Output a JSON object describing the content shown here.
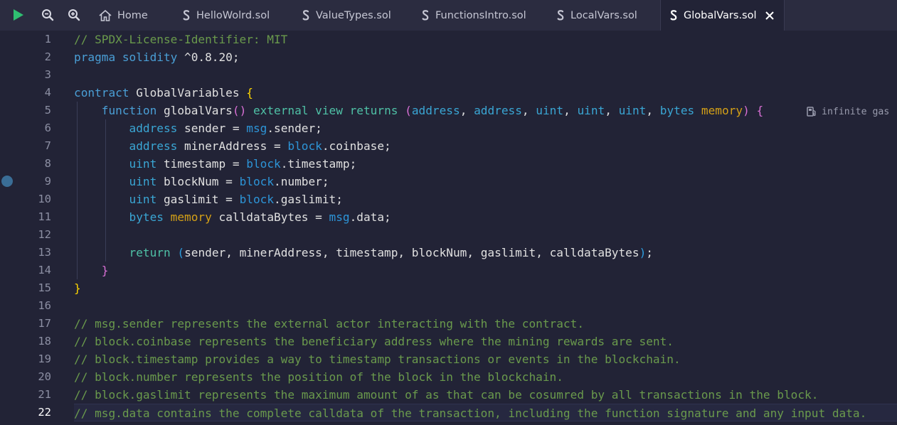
{
  "toolbar": {
    "run_icon": "play-icon",
    "zoom_out_icon": "zoom-out-icon",
    "zoom_in_icon": "zoom-in-icon"
  },
  "tabs": [
    {
      "label": "Home",
      "icon": "home-icon",
      "active": false
    },
    {
      "label": "HelloWolrd.sol",
      "icon": "solidity-icon",
      "active": false
    },
    {
      "label": "ValueTypes.sol",
      "icon": "solidity-icon",
      "active": false
    },
    {
      "label": "FunctionsIntro.sol",
      "icon": "solidity-icon",
      "active": false
    },
    {
      "label": "LocalVars.sol",
      "icon": "solidity-icon",
      "active": false
    },
    {
      "label": "GlobalVars.sol",
      "icon": "solidity-icon",
      "active": true
    }
  ],
  "editor": {
    "current_line": 22,
    "breakpoint_line": 9,
    "gas_hint": "infinite gas",
    "lines": [
      [
        {
          "t": "// SPDX-License-Identifier: MIT",
          "k": "c"
        }
      ],
      [
        {
          "t": "pragma solidity",
          "k": "kw"
        },
        {
          "t": " ^0.8.20;",
          "k": "pl"
        }
      ],
      [],
      [
        {
          "t": "contract",
          "k": "kw"
        },
        {
          "t": " GlobalVariables ",
          "k": "pl"
        },
        {
          "t": "{",
          "k": "br1"
        }
      ],
      [
        {
          "t": "    ",
          "k": "pl"
        },
        {
          "t": "function",
          "k": "kw"
        },
        {
          "t": " globalVars",
          "k": "pl"
        },
        {
          "t": "()",
          "k": "br2"
        },
        {
          "t": " ",
          "k": "pl"
        },
        {
          "t": "external view returns",
          "k": "fn"
        },
        {
          "t": " ",
          "k": "pl"
        },
        {
          "t": "(",
          "k": "br2"
        },
        {
          "t": "address",
          "k": "ty"
        },
        {
          "t": ", ",
          "k": "pl"
        },
        {
          "t": "address",
          "k": "ty"
        },
        {
          "t": ", ",
          "k": "pl"
        },
        {
          "t": "uint",
          "k": "ty"
        },
        {
          "t": ", ",
          "k": "pl"
        },
        {
          "t": "uint",
          "k": "ty"
        },
        {
          "t": ", ",
          "k": "pl"
        },
        {
          "t": "uint",
          "k": "ty"
        },
        {
          "t": ", ",
          "k": "pl"
        },
        {
          "t": "bytes",
          "k": "ty"
        },
        {
          "t": " ",
          "k": "pl"
        },
        {
          "t": "memory",
          "k": "mem"
        },
        {
          "t": ") ",
          "k": "br2"
        },
        {
          "t": "{",
          "k": "br2"
        }
      ],
      [
        {
          "t": "        ",
          "k": "pl"
        },
        {
          "t": "address",
          "k": "ty"
        },
        {
          "t": " sender = ",
          "k": "pl"
        },
        {
          "t": "msg",
          "k": "glb"
        },
        {
          "t": ".sender;",
          "k": "pl"
        }
      ],
      [
        {
          "t": "        ",
          "k": "pl"
        },
        {
          "t": "address",
          "k": "ty"
        },
        {
          "t": " minerAddress = ",
          "k": "pl"
        },
        {
          "t": "block",
          "k": "glb"
        },
        {
          "t": ".coinbase;",
          "k": "pl"
        }
      ],
      [
        {
          "t": "        ",
          "k": "pl"
        },
        {
          "t": "uint",
          "k": "ty"
        },
        {
          "t": " timestamp = ",
          "k": "pl"
        },
        {
          "t": "block",
          "k": "glb"
        },
        {
          "t": ".timestamp;",
          "k": "pl"
        }
      ],
      [
        {
          "t": "        ",
          "k": "pl"
        },
        {
          "t": "uint",
          "k": "ty"
        },
        {
          "t": " blockNum = ",
          "k": "pl"
        },
        {
          "t": "block",
          "k": "glb"
        },
        {
          "t": ".number;",
          "k": "pl"
        }
      ],
      [
        {
          "t": "        ",
          "k": "pl"
        },
        {
          "t": "uint",
          "k": "ty"
        },
        {
          "t": " gaslimit = ",
          "k": "pl"
        },
        {
          "t": "block",
          "k": "glb"
        },
        {
          "t": ".gaslimit;",
          "k": "pl"
        }
      ],
      [
        {
          "t": "        ",
          "k": "pl"
        },
        {
          "t": "bytes",
          "k": "ty"
        },
        {
          "t": " ",
          "k": "pl"
        },
        {
          "t": "memory",
          "k": "mem"
        },
        {
          "t": " calldataBytes = ",
          "k": "pl"
        },
        {
          "t": "msg",
          "k": "glb"
        },
        {
          "t": ".data;",
          "k": "pl"
        }
      ],
      [],
      [
        {
          "t": "        ",
          "k": "pl"
        },
        {
          "t": "return",
          "k": "fn"
        },
        {
          "t": " ",
          "k": "pl"
        },
        {
          "t": "(",
          "k": "br3"
        },
        {
          "t": "sender, minerAddress, timestamp, blockNum, gaslimit, calldataBytes",
          "k": "pl"
        },
        {
          "t": ")",
          "k": "br3"
        },
        {
          "t": ";",
          "k": "pl"
        }
      ],
      [
        {
          "t": "    ",
          "k": "pl"
        },
        {
          "t": "}",
          "k": "br2"
        }
      ],
      [
        {
          "t": "}",
          "k": "br1"
        }
      ],
      [],
      [
        {
          "t": "// msg.sender represents the external actor interacting with the contract.",
          "k": "c"
        }
      ],
      [
        {
          "t": "// block.coinbase represents the beneficiary address where the mining rewards are sent.",
          "k": "c"
        }
      ],
      [
        {
          "t": "// block.timestamp provides a way to timestamp transactions or events in the blockchain.",
          "k": "c"
        }
      ],
      [
        {
          "t": "// block.number represents the position of the block in the blockchain.",
          "k": "c"
        }
      ],
      [
        {
          "t": "// block.gaslimit represents the maximum amount of as that can be cosumred by all transactions in the block.",
          "k": "c"
        }
      ],
      [
        {
          "t": "// msg.data contains the complete calldata of the transaction, including the function signature and any input data.",
          "k": "c"
        }
      ]
    ]
  },
  "colors": {
    "background": "#222336",
    "tabbar": "#2b2c40",
    "run_green": "#2fbf71",
    "comment": "#6a9a4c",
    "keyword": "#4a9fd6",
    "breakpoint": "#3a6d96"
  }
}
